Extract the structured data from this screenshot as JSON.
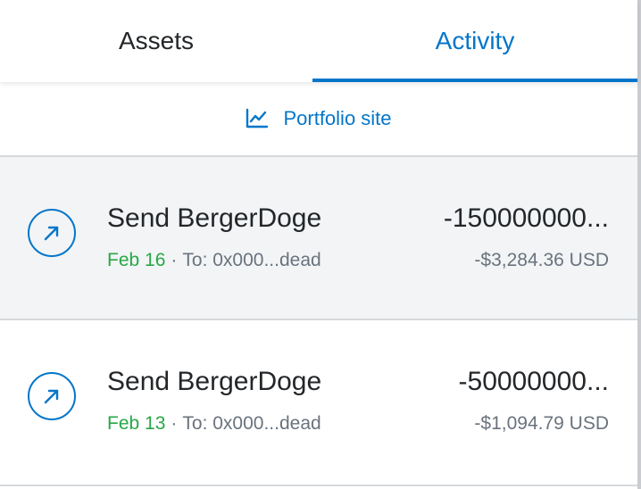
{
  "tabs": [
    {
      "label": "Assets",
      "active": false
    },
    {
      "label": "Activity",
      "active": true
    }
  ],
  "portfolio_link": {
    "label": "Portfolio site",
    "icon": "chart-line-icon"
  },
  "colors": {
    "accent": "#0376c9",
    "success": "#28a745",
    "text": "#24272a",
    "muted": "#6a737d"
  },
  "transactions": [
    {
      "title": "Send BergerDoge",
      "date": "Feb 16",
      "separator": "·",
      "to": "To: 0x000...dead",
      "amount": "-150000000...",
      "fiat": "-$3,284.36 USD",
      "icon": "send-arrow-icon"
    },
    {
      "title": "Send BergerDoge",
      "date": "Feb 13",
      "separator": "·",
      "to": "To: 0x000...dead",
      "amount": "-50000000...",
      "fiat": "-$1,094.79 USD",
      "icon": "send-arrow-icon"
    }
  ]
}
